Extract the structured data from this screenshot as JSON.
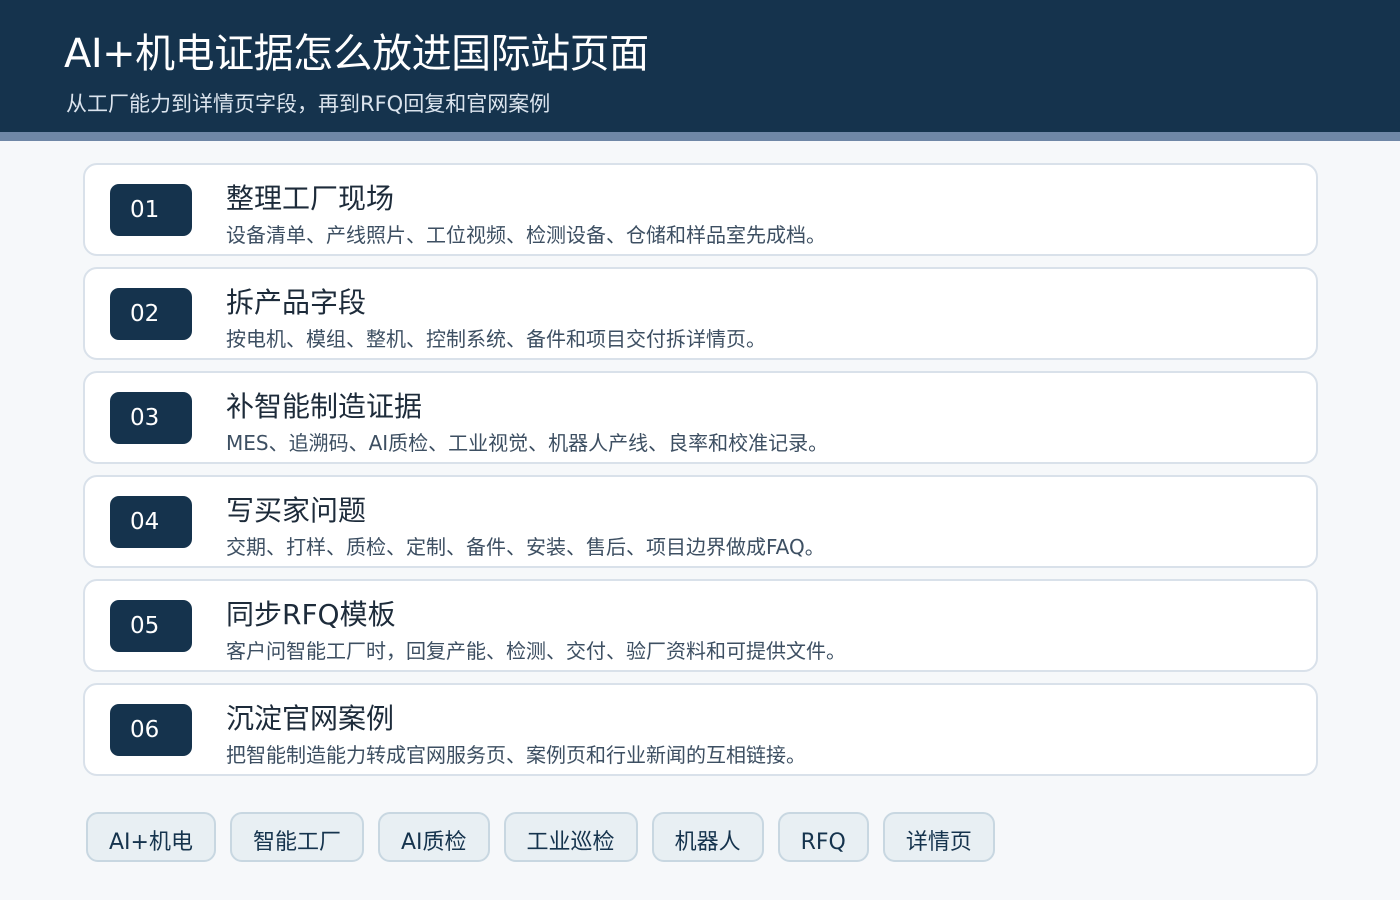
{
  "header": {
    "title": "AI+机电证据怎么放进国际站页面",
    "subtitle": "从工厂能力到详情页字段，再到RFQ回复和官网案例"
  },
  "steps": [
    {
      "num": "01",
      "title": "整理工厂现场",
      "desc": "设备清单、产线照片、工位视频、检测设备、仓储和样品室先成档。"
    },
    {
      "num": "02",
      "title": "拆产品字段",
      "desc": "按电机、模组、整机、控制系统、备件和项目交付拆详情页。"
    },
    {
      "num": "03",
      "title": "补智能制造证据",
      "desc": "MES、追溯码、AI质检、工业视觉、机器人产线、良率和校准记录。"
    },
    {
      "num": "04",
      "title": "写买家问题",
      "desc": "交期、打样、质检、定制、备件、安装、售后、项目边界做成FAQ。"
    },
    {
      "num": "05",
      "title": "同步RFQ模板",
      "desc": "客户问智能工厂时，回复产能、检测、交付、验厂资料和可提供文件。"
    },
    {
      "num": "06",
      "title": "沉淀官网案例",
      "desc": "把智能制造能力转成官网服务页、案例页和行业新闻的互相链接。"
    }
  ],
  "tags": [
    "AI+机电",
    "智能工厂",
    "AI质检",
    "工业巡检",
    "机器人",
    "RFQ",
    "详情页"
  ],
  "colors": {
    "header_bg": "#15334d",
    "header_stripe": "#6f87a6",
    "badge_bg": "#15334d",
    "card_border": "#d9e1ea",
    "tag_bg": "#e8eff3"
  }
}
